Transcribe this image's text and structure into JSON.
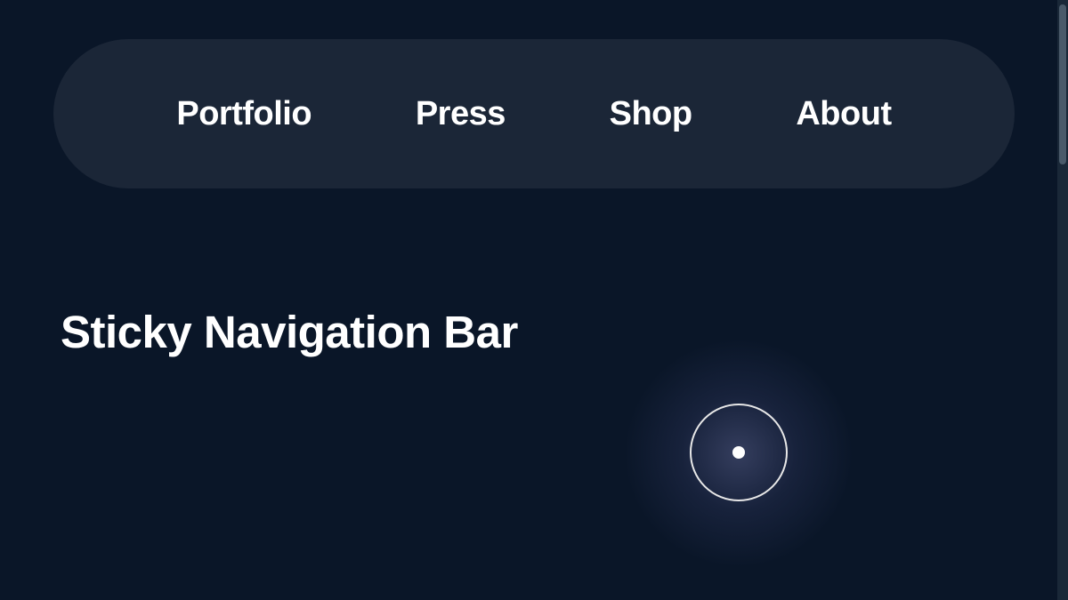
{
  "nav": {
    "items": [
      {
        "label": "Portfolio"
      },
      {
        "label": "Press"
      },
      {
        "label": "Shop"
      },
      {
        "label": "About"
      }
    ]
  },
  "heading": {
    "title": "Sticky Navigation Bar"
  }
}
